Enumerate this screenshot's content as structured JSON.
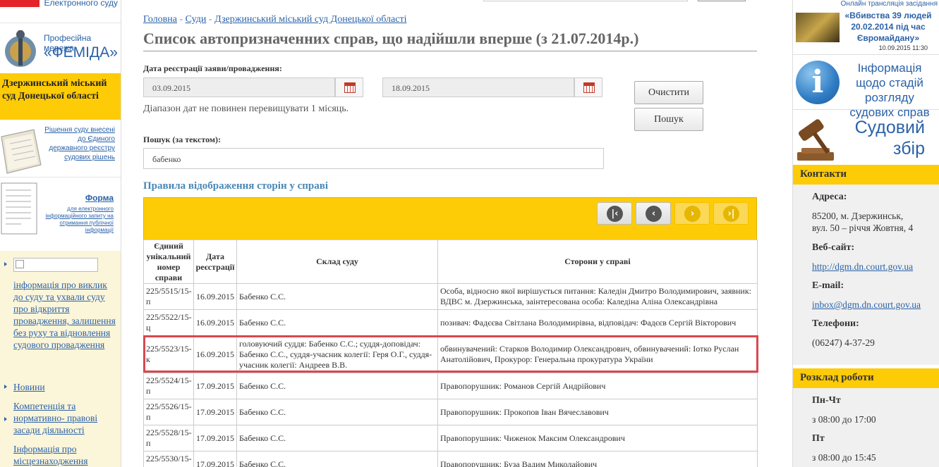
{
  "left": {
    "ecourt_label": "Електронного суду",
    "femida_line1": "Професійна мережа",
    "femida_line2": "«ФЕМІДА»",
    "court_name": "Дзержинський міський суд Донецької області",
    "decisions_link": "Рішення суду внесені до Єдиного державного реєстру судових рішень",
    "form_title": "Форма",
    "form_subtitle": "для електронного інформаційного запиту на отримання публічної інформації",
    "menu": [
      "інформація про виклик до суду та ухвали суду про відкриття провадження, залишення без руху та відновлення судового провадження",
      "Новини",
      "Компетенція та нормативно- правові засади діяльності",
      "Інформація про місцезнаходження"
    ]
  },
  "main": {
    "breadcrumb": [
      "Головна",
      "Суди",
      "Дзержинський міський суд Донецької області"
    ],
    "breadcrumb_sep": " - ",
    "title": "Список автопризначенних справ, що надійшли вперше (з 21.07.2014р.)",
    "date_label": "Дата реєстрації заяви/провадження:",
    "date_from": "03.09.2015",
    "date_to": "18.09.2015",
    "range_hint": "Діапазон дат не повинен перевищувати 1 місяць.",
    "clear_button": "Очистити",
    "search_button": "Пошук",
    "text_search_label": "Пошук (за текстом):",
    "text_search_value": "бабенко",
    "rules_link": "Правила відображення сторін у справі",
    "table": {
      "headers": [
        "Єдиний унікальний номер справи",
        "Дата реєстрації",
        "Склад суду",
        "Сторони у справі"
      ],
      "rows": [
        [
          "225/5515/15-п",
          "16.09.2015",
          "Бабенко С.С.",
          "Особа, відносно якої вирішується питання: Каледін Дмитро Володимирович, заявник: ВДВС м. Дзержинська, заінтересована особа: Каледіна Аліна Олександрівна"
        ],
        [
          "225/5522/15-ц",
          "16.09.2015",
          "Бабенко С.С.",
          "позивач: Фадєєва Світлана Володимирівна, відповідач: Фадєєв Сергій Вікторович"
        ],
        [
          "225/5523/15-к",
          "16.09.2015",
          "головуючий суддя: Бабенко С.С.; суддя-доповідач: Бабенко С.С., суддя-учасник колегії: Геря О.Г., суддя-учасник колегії: Андреев В.В.",
          "обвинувачений: Старков Володимир Олександрович, обвинувачений: Іотко Руслан Анатолійович, Прокурор: Генеральна прокуратура України"
        ],
        [
          "225/5524/15-п",
          "17.09.2015",
          "Бабенко С.С.",
          "Правопорушник: Романов Сергій Андрійович"
        ],
        [
          "225/5526/15-п",
          "17.09.2015",
          "Бабенко С.С.",
          "Правопорушник: Прокопов Іван Вячеславович"
        ],
        [
          "225/5528/15-п",
          "17.09.2015",
          "Бабенко С.С.",
          "Правопорушник: Чиженок Максим Олександрович"
        ],
        [
          "225/5530/15-п",
          "17.09.2015",
          "Бабенко С.С.",
          "Правопорушник: Буза Вадим Миколайович"
        ]
      ]
    }
  },
  "right": {
    "banner1_top": "Онлайн трансляція засідання",
    "banner1_title": "«Вбивства 39 людей 20.02.2014 під час Євромайдану»",
    "banner1_date": "10.09.2015 11:30",
    "banner2_text": "Інформація щодо стадій розгляду судових справ",
    "banner3_text": "Судовий збір",
    "contacts_title": "Контакти",
    "address_label": "Адреса:",
    "address_line1": "85200, м. Дзержинськ,",
    "address_line2": "вул. 50 – річчя Жовтня, 4",
    "website_label": "Веб-сайт:",
    "website": "http://dgm.dn.court.gov.ua",
    "email_label": "E-mail:",
    "email": "inbox@dgm.dn.court.gov.ua",
    "phone_label": "Телефони:",
    "phone": "(06247) 4-37-29",
    "schedule_title": "Розклад роботи",
    "schedule": [
      {
        "days": "Пн-Чт",
        "hours": "з 08:00 до 17:00"
      },
      {
        "days": "Пт",
        "hours": "з 08:00 до 15:45"
      }
    ]
  },
  "colors": {
    "accent": "#fecb07",
    "link": "#2a62a8",
    "highlight": "#d9484f"
  }
}
